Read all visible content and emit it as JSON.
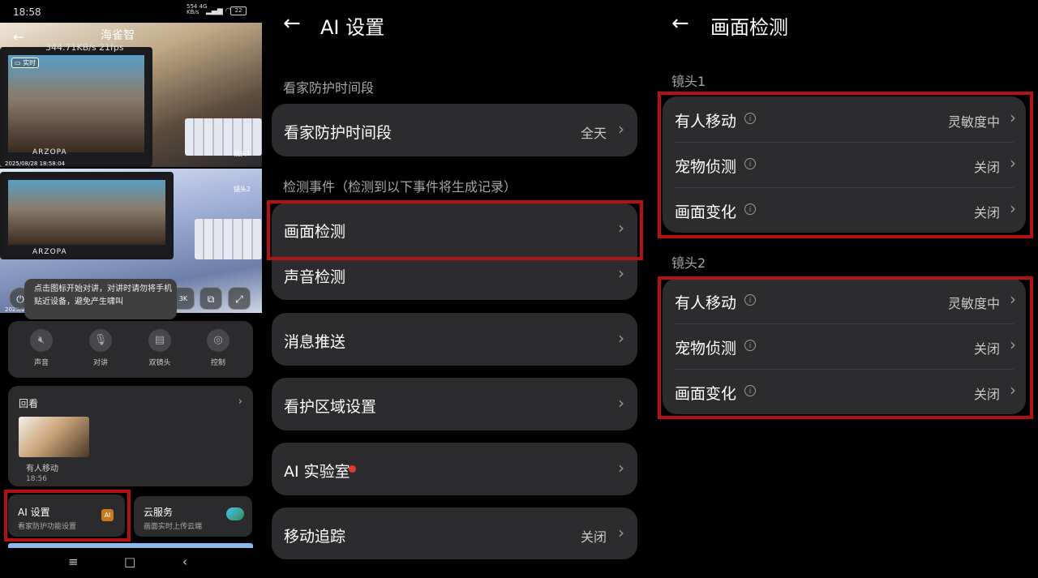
{
  "accent": "#b31212",
  "panel1": {
    "status": {
      "time": "18:58",
      "net": "554 4G\nKB/s",
      "battery": "22"
    },
    "camera": {
      "name": "海雀智",
      "rate": "344.71KB/s",
      "fps": "21fps",
      "live": "实时",
      "brand": "ARZOPA",
      "timestamp": "2025/08/28 18:58:04",
      "cam1": "镜头1",
      "cam2": "镜头2",
      "timestamp2": "2025/08",
      "quality": "3K"
    },
    "tooltip": "点击图标开始对讲，对讲时请勿将手机贴近设备，避免产生啸叫",
    "controls": [
      {
        "label": "声音",
        "icon": "mute-icon"
      },
      {
        "label": "对讲",
        "icon": "microphone-icon"
      },
      {
        "label": "双镜头",
        "icon": "dual-lens-icon"
      },
      {
        "label": "控制",
        "icon": "joystick-icon"
      }
    ],
    "replay": {
      "title": "回看",
      "event": "有人移动",
      "time": "18:56"
    },
    "ai_card": {
      "title": "AI 设置",
      "subtitle": "看家防护功能设置",
      "badge": "AI"
    },
    "cloud_card": {
      "title": "云服务",
      "subtitle": "画面实时上传云端"
    }
  },
  "panel2": {
    "title": "AI 设置",
    "section1": "看家防护时间段",
    "guard_period": {
      "label": "看家防护时间段",
      "value": "全天"
    },
    "section2": "检测事件（检测到以下事件将生成记录）",
    "items": [
      {
        "label": "画面检测"
      },
      {
        "label": "声音检测"
      },
      {
        "label": "消息推送"
      },
      {
        "label": "看护区域设置"
      },
      {
        "label": "AI 实验室"
      },
      {
        "label": "移动追踪",
        "value": "关闭"
      }
    ]
  },
  "panel3": {
    "title": "画面检测",
    "lens1": {
      "title": "镜头1",
      "rows": [
        {
          "label": "有人移动",
          "value": "灵敏度中"
        },
        {
          "label": "宠物侦测",
          "value": "关闭"
        },
        {
          "label": "画面变化",
          "value": "关闭"
        }
      ]
    },
    "lens2": {
      "title": "镜头2",
      "rows": [
        {
          "label": "有人移动",
          "value": "灵敏度中"
        },
        {
          "label": "宠物侦测",
          "value": "关闭"
        },
        {
          "label": "画面变化",
          "value": "关闭"
        }
      ]
    }
  }
}
